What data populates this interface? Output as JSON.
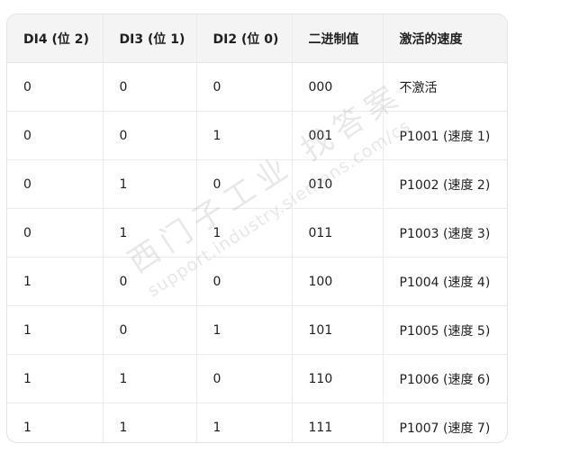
{
  "table": {
    "headers": [
      "DI4 (位 2)",
      "DI3 (位 1)",
      "DI2 (位 0)",
      "二进制值",
      "激活的速度"
    ],
    "rows": [
      [
        "0",
        "0",
        "0",
        "000",
        "不激活"
      ],
      [
        "0",
        "0",
        "1",
        "001",
        "P1001 (速度 1)"
      ],
      [
        "0",
        "1",
        "0",
        "010",
        "P1002 (速度 2)"
      ],
      [
        "0",
        "1",
        "1",
        "011",
        "P1003 (速度 3)"
      ],
      [
        "1",
        "0",
        "0",
        "100",
        "P1004 (速度 4)"
      ],
      [
        "1",
        "0",
        "1",
        "101",
        "P1005 (速度 5)"
      ],
      [
        "1",
        "1",
        "0",
        "110",
        "P1006 (速度 6)"
      ],
      [
        "1",
        "1",
        "1",
        "111",
        "P1007 (速度 7)"
      ]
    ]
  },
  "watermark": {
    "brand": "西门子工业 找答案",
    "url": "support.industry.siemens.com/cs"
  }
}
